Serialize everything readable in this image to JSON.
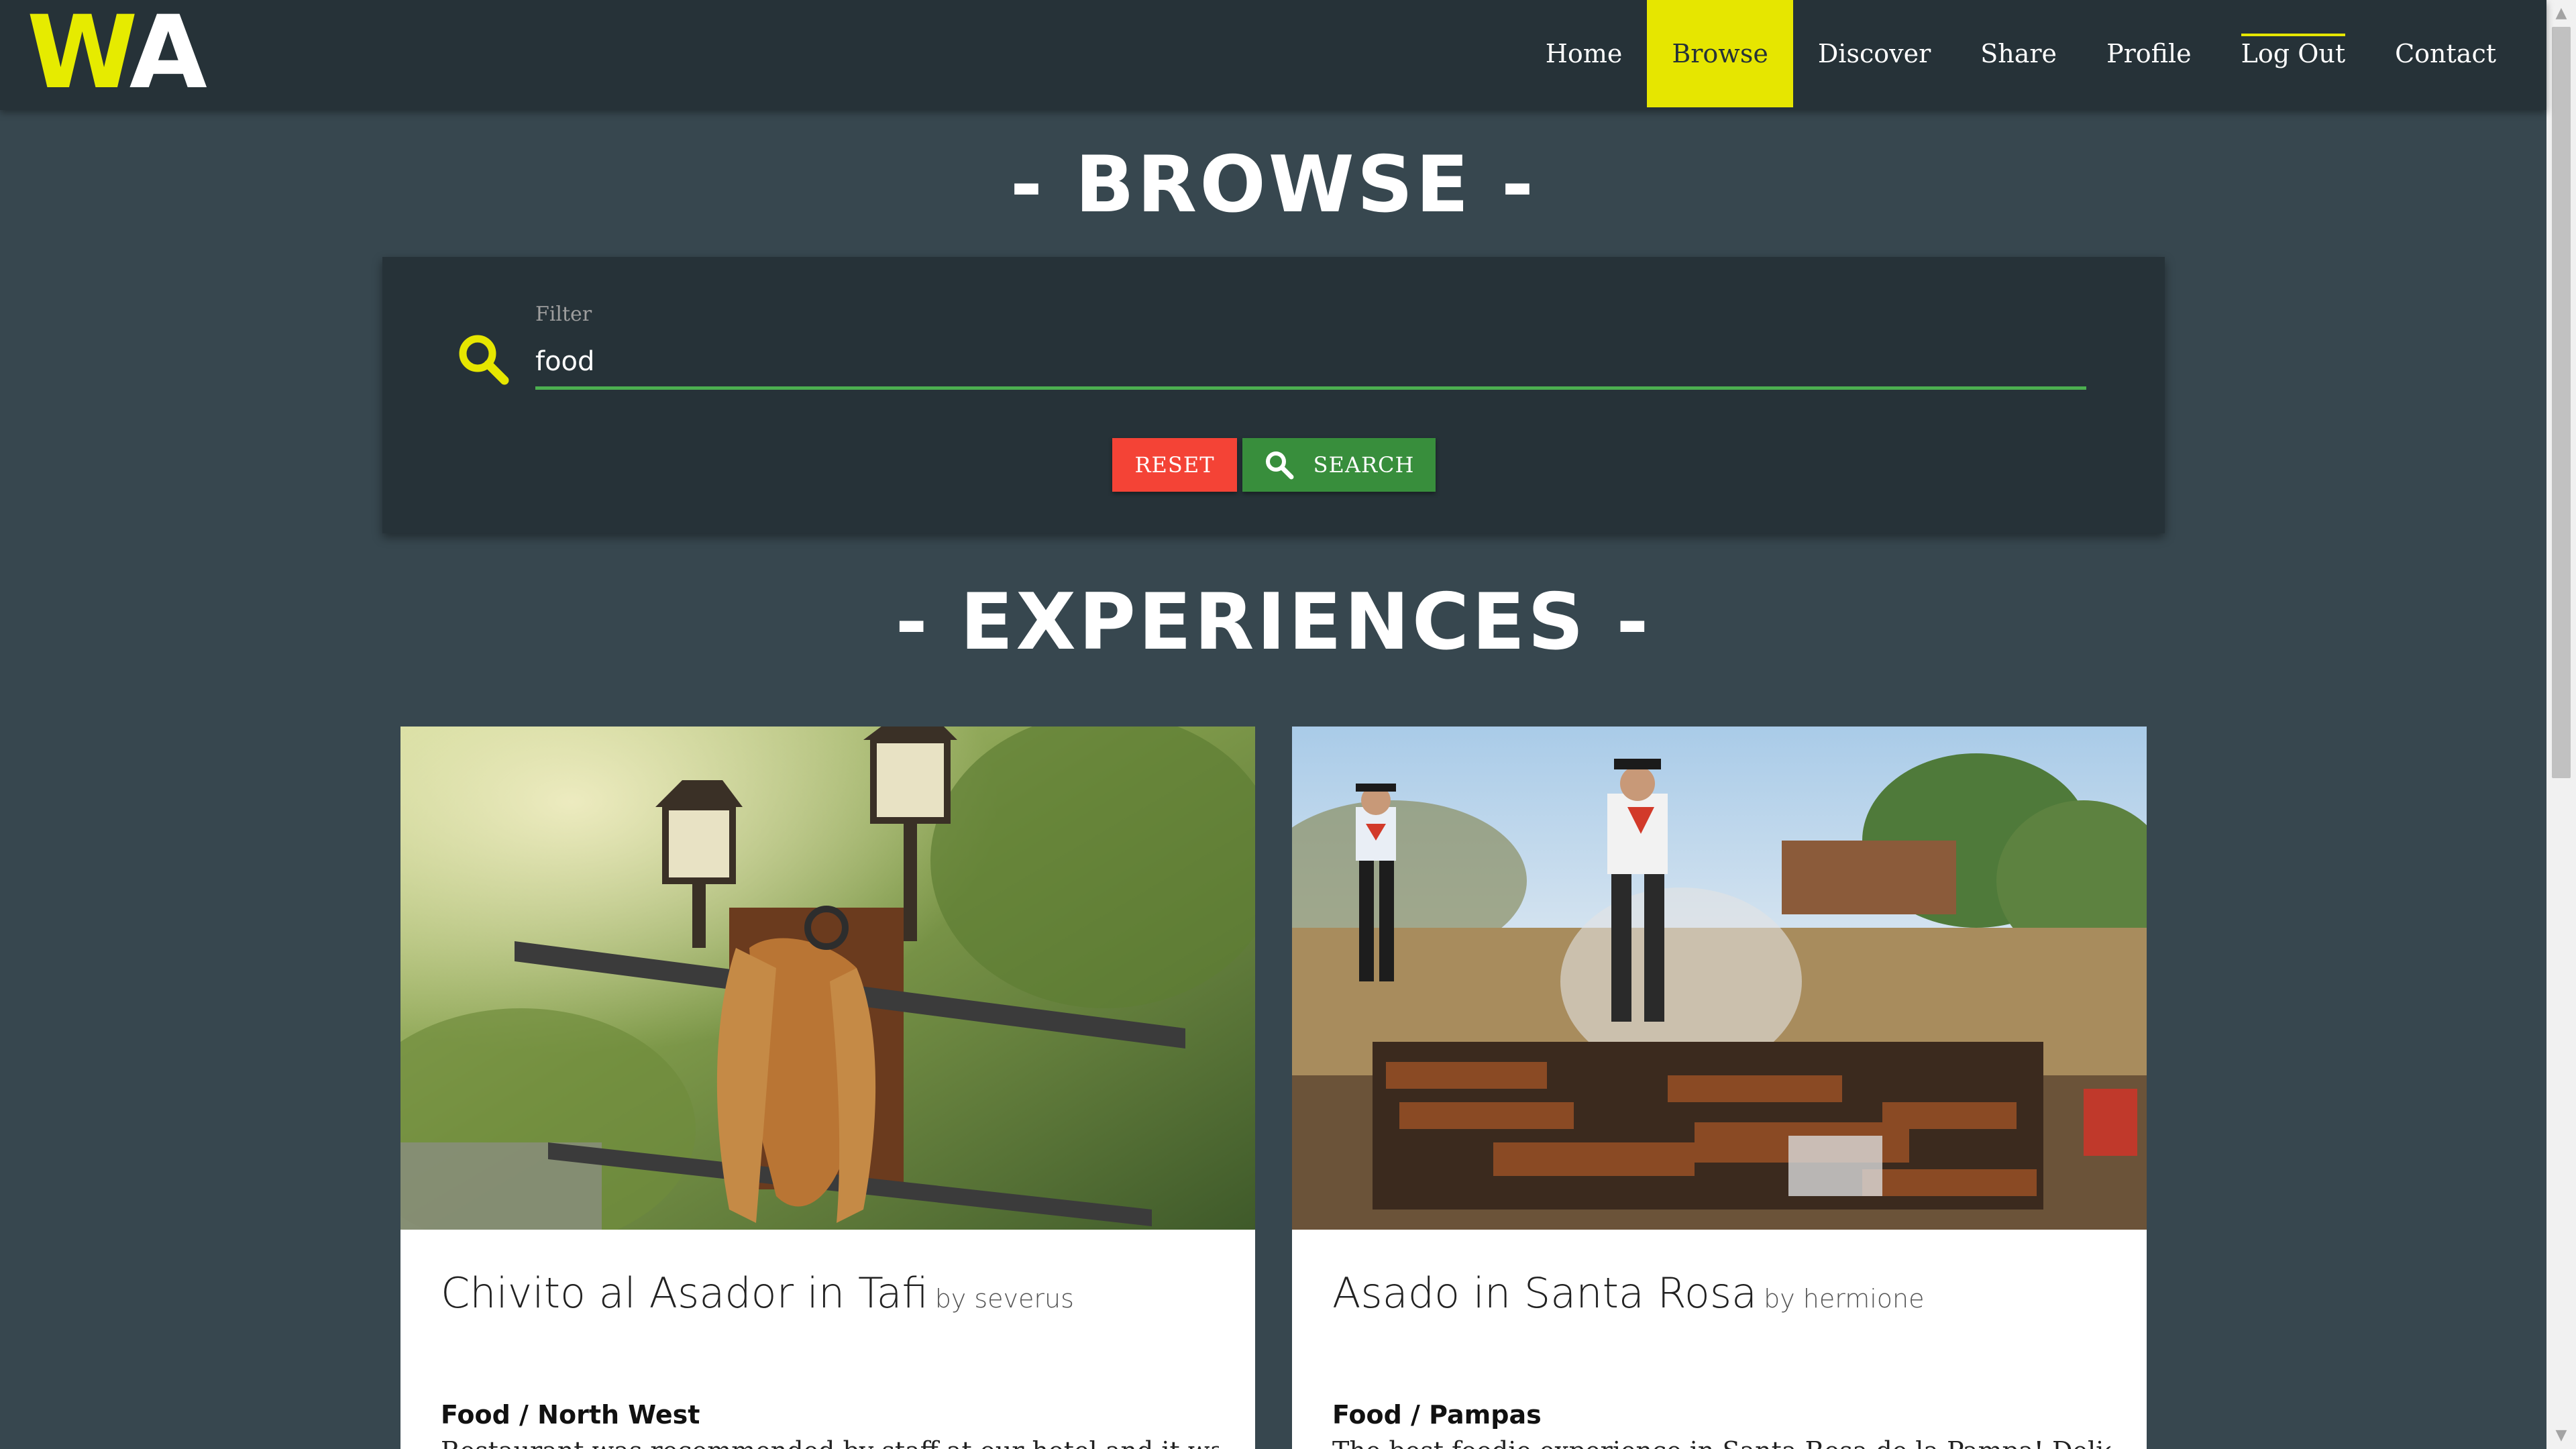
{
  "nav": {
    "logo_w": "W",
    "logo_a": "A",
    "items": [
      {
        "label": "Home"
      },
      {
        "label": "Browse"
      },
      {
        "label": "Discover"
      },
      {
        "label": "Share"
      },
      {
        "label": "Profile"
      },
      {
        "label": "Log Out"
      },
      {
        "label": "Contact"
      }
    ],
    "active": "Browse"
  },
  "browse": {
    "title": "- BROWSE -",
    "filter_label": "Filter",
    "filter_value": "food",
    "reset_label": "RESET",
    "search_label": "SEARCH"
  },
  "experiences": {
    "title": "- EXPERIENCES -",
    "cards": [
      {
        "title": "Chivito al Asador in Tafi",
        "by": "by severus",
        "category": "Food / North West",
        "description": "Restaurant was recommended by staff at our hotel and it was well"
      },
      {
        "title": "Asado in Santa Rosa",
        "by": "by hermione",
        "category": "Food / Pampas",
        "description": "The best foodie experience in Santa Rosa de la Pampa! Delicious beef"
      }
    ]
  },
  "colors": {
    "accent": "#e6e600",
    "nav_bg": "#263238",
    "page_bg": "#37474f",
    "reset": "#f44336",
    "search": "#388e3c",
    "input_underline": "#4caf50"
  }
}
